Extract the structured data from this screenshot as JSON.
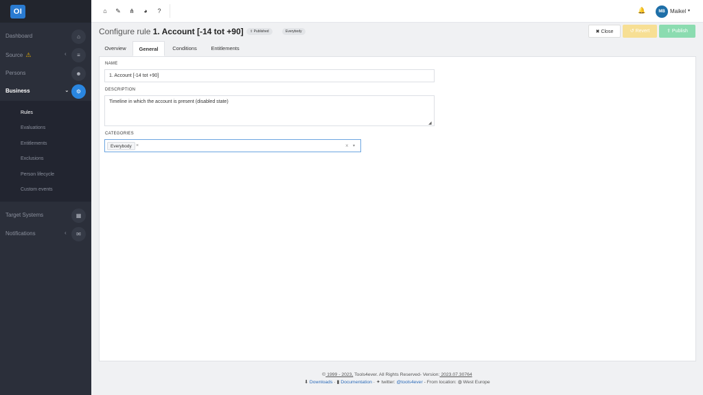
{
  "app": {
    "logo_text": "OI"
  },
  "sidebar": {
    "items": [
      {
        "label": "Dashboard",
        "icon": "home-icon",
        "glyph": "⌂"
      },
      {
        "label": "Source",
        "icon": "database-icon",
        "glyph": "≡",
        "warning": "⚠",
        "chevron": "‹"
      },
      {
        "label": "Persons",
        "icon": "users-icon",
        "glyph": "☻"
      },
      {
        "label": "Business",
        "icon": "cog-icon",
        "glyph": "⚙",
        "chevron": "⌄"
      },
      {
        "label": "Target Systems",
        "icon": "grid-icon",
        "glyph": "▦"
      },
      {
        "label": "Notifications",
        "icon": "envelope-icon",
        "glyph": "✉",
        "chevron": "‹"
      }
    ],
    "sub_items": [
      "Rules",
      "Evaluations",
      "Entitlements",
      "Exclusions",
      "Person lifecycle",
      "Custom events"
    ]
  },
  "topbar": {
    "icons": [
      "home-icon",
      "wrench-icon",
      "sitemap-icon",
      "pie-chart-icon",
      "help-icon"
    ],
    "glyphs": [
      "⌂",
      "✎",
      "⋔",
      "◕",
      "?"
    ],
    "bell_glyph": "🔔",
    "user_initials": "MB",
    "user_name": "Maikel",
    "caret": "▾"
  },
  "header": {
    "title_prefix": "Configure rule ",
    "title_main": "1. Account [-14 tot +90]",
    "badge_published": "Published",
    "badge_published_icon": "⇪ ",
    "badge_everybody": "Everybody",
    "close_label": "✖ Close",
    "revert_label": "↺ Revert",
    "publish_label": "⇪ Publish"
  },
  "tabs": [
    "Overview",
    "General",
    "Conditions",
    "Entitlements"
  ],
  "form": {
    "name_label": "NAME",
    "name_value": "1. Account [-14 tot +90]",
    "description_label": "DESCRIPTION",
    "description_value": "Timeline in which the account is present (disabled state)",
    "categories_label": "CATEGORIES",
    "category_tag": "Everybody",
    "tag_remove": "×",
    "clear": "×",
    "caret": "▾"
  },
  "footer": {
    "copyright_symbol": "©",
    "years": " 1999 - 2023,",
    "company": " Tools4ever. All Rights Reserved- Version:",
    "version": " 2023.07.30764",
    "downloads": "Downloads",
    "documentation": "Documentation",
    "twitter_prefix": " twitter: ",
    "twitter_handle": "@tools4ever",
    "location_prefix": " - From location: ",
    "location": " West Europe"
  }
}
